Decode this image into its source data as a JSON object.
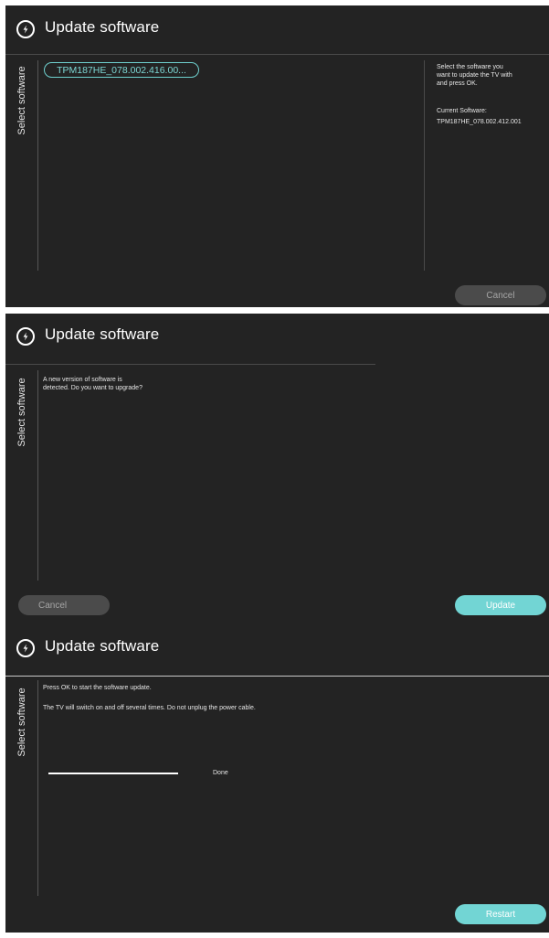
{
  "screens": [
    {
      "title": "Update software",
      "side_label": "Select software",
      "software_option": "TPM187HE_078.002.416.00...",
      "help_text": "Select the software you\nwant to update the TV with\nand press OK.",
      "current_software_label": "Current Software:",
      "current_software_value": "TPM187HE_078.002.412.001",
      "cancel_label": "Cancel"
    },
    {
      "title": "Update software",
      "side_label": "Select software",
      "message": "A new version of software is\ndetected. Do you want to upgrade?",
      "cancel_label": "Cancel",
      "update_label": "Update"
    },
    {
      "title": "Update software",
      "side_label": "Select software",
      "message_line1": "Press OK to start the software update.",
      "message_line2": "The TV will switch on and off several times. Do not unplug the power cable.",
      "progress_fraction": 1.0,
      "progress_status": "Done",
      "restart_label": "Restart"
    }
  ],
  "icon": "power-icon",
  "colors": {
    "background": "#232323",
    "accent": "#72d5d4",
    "button_grey": "#4b4b4b"
  }
}
